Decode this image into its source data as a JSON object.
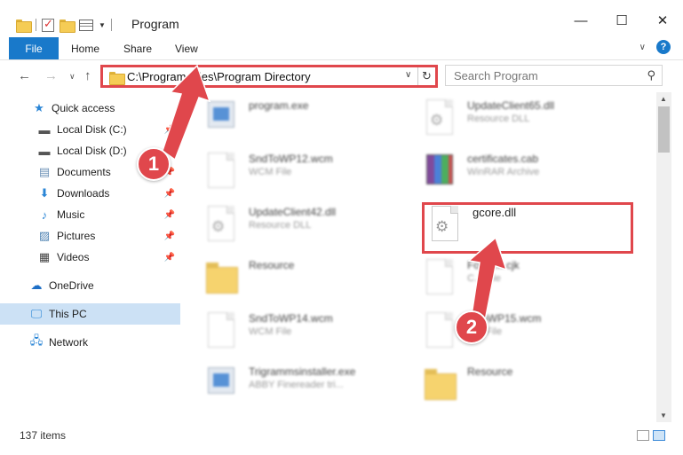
{
  "window": {
    "title": "Program",
    "minimize_glyph": "—",
    "maximize_glyph": "☐",
    "close_glyph": "✕"
  },
  "ribbon": {
    "file": "File",
    "home": "Home",
    "share": "Share",
    "view": "View"
  },
  "address": {
    "path": "C:\\Program Files\\Program Directory",
    "search_placeholder": "Search Program"
  },
  "sidebar": {
    "items": [
      {
        "label": "Quick access",
        "icon": "star-icon"
      },
      {
        "label": "Local Disk (C:)",
        "icon": "drive-icon",
        "pinned": true
      },
      {
        "label": "Local Disk (D:)",
        "icon": "drive-icon",
        "pinned": true
      },
      {
        "label": "Documents",
        "icon": "documents-icon",
        "pinned": true
      },
      {
        "label": "Downloads",
        "icon": "download-icon",
        "pinned": true
      },
      {
        "label": "Music",
        "icon": "music-icon",
        "pinned": true
      },
      {
        "label": "Pictures",
        "icon": "pictures-icon",
        "pinned": true
      },
      {
        "label": "Videos",
        "icon": "videos-icon",
        "pinned": true
      },
      {
        "label": "OneDrive",
        "icon": "cloud-icon"
      },
      {
        "label": "This PC",
        "icon": "computer-icon",
        "selected": true
      },
      {
        "label": "Network",
        "icon": "network-icon"
      }
    ]
  },
  "files": [
    {
      "name": "program.exe",
      "type": "",
      "icon": "exe-icon"
    },
    {
      "name": "UpdateClient65.dll",
      "type": "Resource DLL",
      "icon": "dll-icon"
    },
    {
      "name": "SndToWP12.wcm",
      "type": "WCM File",
      "icon": "document-icon"
    },
    {
      "name": "certificates.cab",
      "type": "WinRAR Archive",
      "icon": "archive-icon"
    },
    {
      "name": "UpdateClient42.dll",
      "type": "Resource DLL",
      "icon": "dll-icon"
    },
    {
      "name": "gcore.dll",
      "type": "",
      "icon": "dll-icon"
    },
    {
      "name": "Resource",
      "type": "",
      "icon": "folder-icon"
    },
    {
      "name": "Fo...em.cjk",
      "type": "C... File",
      "icon": "document-icon"
    },
    {
      "name": "SndToWP14.wcm",
      "type": "WCM File",
      "icon": "document-icon"
    },
    {
      "name": "...ToWP15.wcm",
      "type": "...M File",
      "icon": "document-icon"
    },
    {
      "name": "Trigrammsinstaller.exe",
      "type": "ABBY Finereader tri...",
      "icon": "exe-icon"
    },
    {
      "name": "Resource",
      "type": "",
      "icon": "folder-icon"
    }
  ],
  "status": {
    "count": "137 items"
  },
  "callouts": {
    "step1": "1",
    "step2": "2"
  },
  "colors": {
    "accent": "#1979ca",
    "highlight": "#e0474c",
    "selected": "#cce1f5"
  }
}
